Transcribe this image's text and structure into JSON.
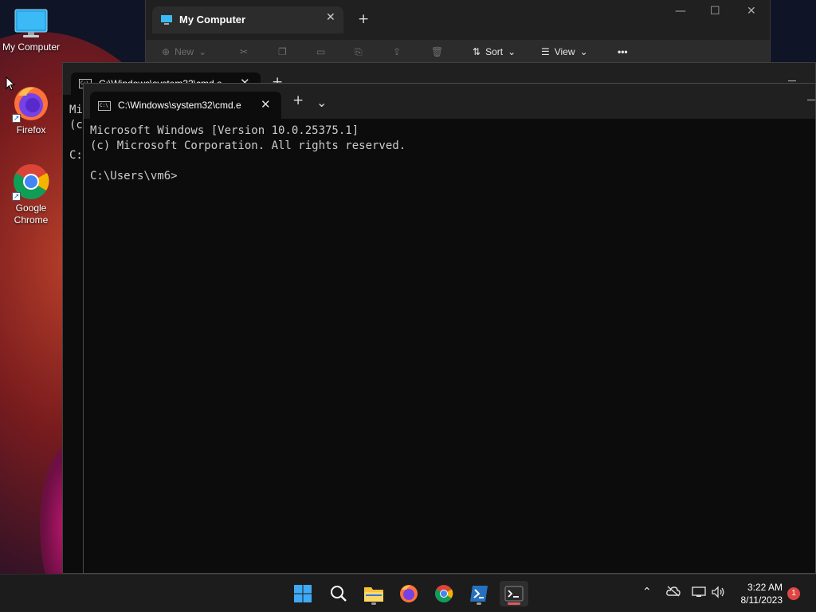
{
  "desktop": {
    "icons": [
      {
        "label": "My Computer",
        "icon": "monitor-icon"
      },
      {
        "label": "Firefox",
        "icon": "firefox-icon"
      },
      {
        "label": "Google Chrome",
        "icon": "chrome-icon"
      }
    ]
  },
  "explorer": {
    "tab_title": "My Computer",
    "toolbar": {
      "new_label": "New",
      "sort_label": "Sort",
      "view_label": "View"
    }
  },
  "terminal_back": {
    "tab_title": "C:\\Windows\\system32\\cmd.e",
    "console_lines": [
      "Mi",
      "(c",
      "",
      "C:"
    ]
  },
  "terminal": {
    "tab_title": "C:\\Windows\\system32\\cmd.e",
    "console": "Microsoft Windows [Version 10.0.25375.1]\n(c) Microsoft Corporation. All rights reserved.\n\nC:\\Users\\vm6>"
  },
  "taskbar": {
    "apps": [
      "windows-start",
      "search",
      "file-explorer",
      "firefox",
      "chrome",
      "powershell",
      "terminal"
    ],
    "time": "3:22 AM",
    "date": "8/11/2023",
    "notification_count": "1"
  },
  "colors": {
    "terminal_bg": "#0c0c0c",
    "titlebar_bg": "#202020",
    "taskbar_bg": "#1c1c1c",
    "badge_red": "#e04545"
  }
}
